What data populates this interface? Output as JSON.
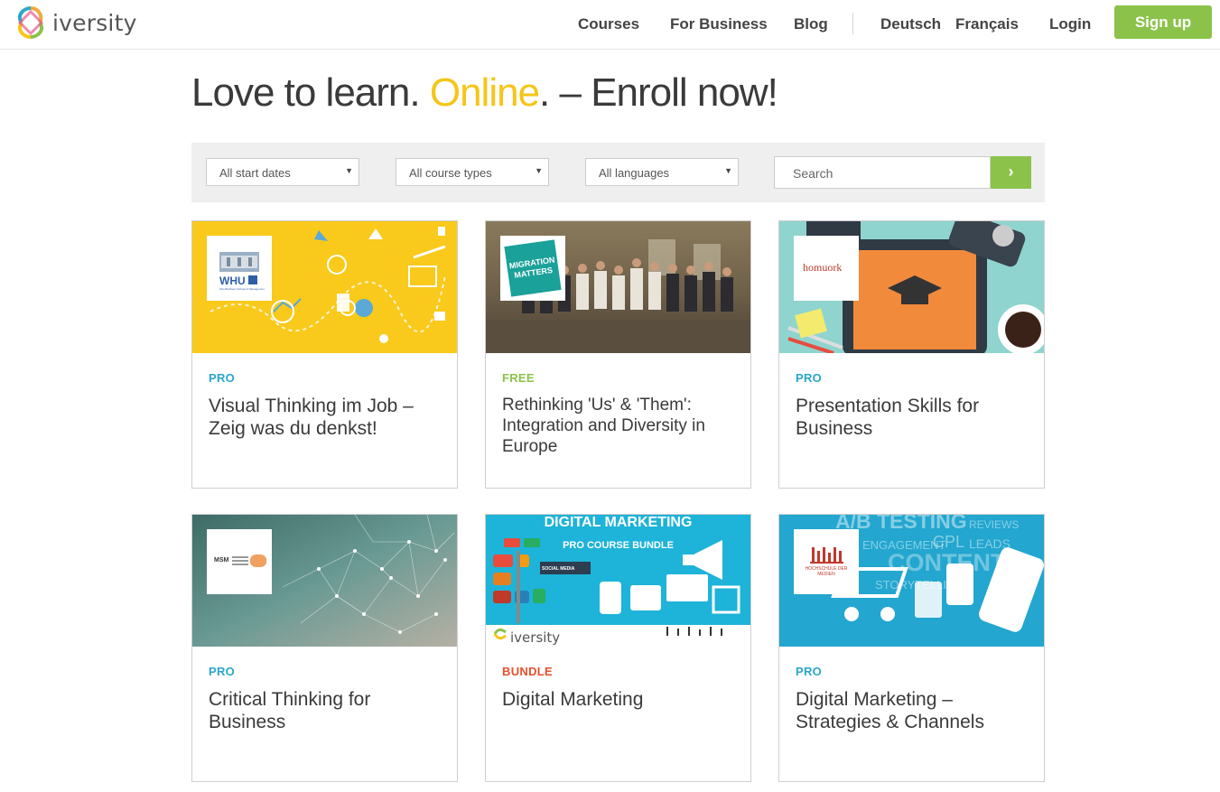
{
  "brand": {
    "name": "iversity"
  },
  "nav": {
    "courses": "Courses",
    "for_business": "For Business",
    "blog": "Blog",
    "deutsch": "Deutsch",
    "francais": "Français",
    "login": "Login",
    "signup": "Sign up"
  },
  "hero": {
    "part1": "Love to learn. ",
    "highlight": "Online",
    "part2": ". – Enroll now!"
  },
  "filters": {
    "start_dates": "All start dates",
    "course_types": "All course types",
    "languages": "All languages",
    "search_placeholder": "Search"
  },
  "colors": {
    "accent_green": "#8bc34a",
    "highlight_yellow": "#f5c518",
    "pro": "#2aa7c9",
    "free": "#8bc34a",
    "bundle": "#e5502d"
  },
  "cards": [
    {
      "tag": "PRO",
      "title": "Visual Thinking im Job – Zeig was du denkst!",
      "logo_text": "WHU",
      "logo_sub": "Otto Beisheim School of Management"
    },
    {
      "tag": "FREE",
      "title": "Rethinking 'Us' & 'Them': Integration and Diversity in Europe",
      "logo_text": "MIGRATION MATTERS"
    },
    {
      "tag": "PRO",
      "title": "Presentation Skills for Business",
      "logo_text": "homuork"
    },
    {
      "tag": "PRO",
      "title": "Critical Thinking for Business",
      "logo_text": "MSM"
    },
    {
      "tag": "BUNDLE",
      "title": "Digital Marketing",
      "banner_title": "DIGITAL MARKETING",
      "banner_sub": "PRO COURSE BUNDLE",
      "banner_brand": "iversity",
      "banner_chip": "SOCIAL MEDIA"
    },
    {
      "tag": "PRO",
      "title": "Digital Marketing – Strategies & Channels",
      "logo_text": "HOCHSCHULE DER MEDIEN",
      "bg_words": [
        "A/B TESTING",
        "ENGAGEMENT",
        "CPL",
        "LEADS",
        "CONTENT",
        "STORYTELLING",
        "REVIEWS"
      ]
    }
  ]
}
